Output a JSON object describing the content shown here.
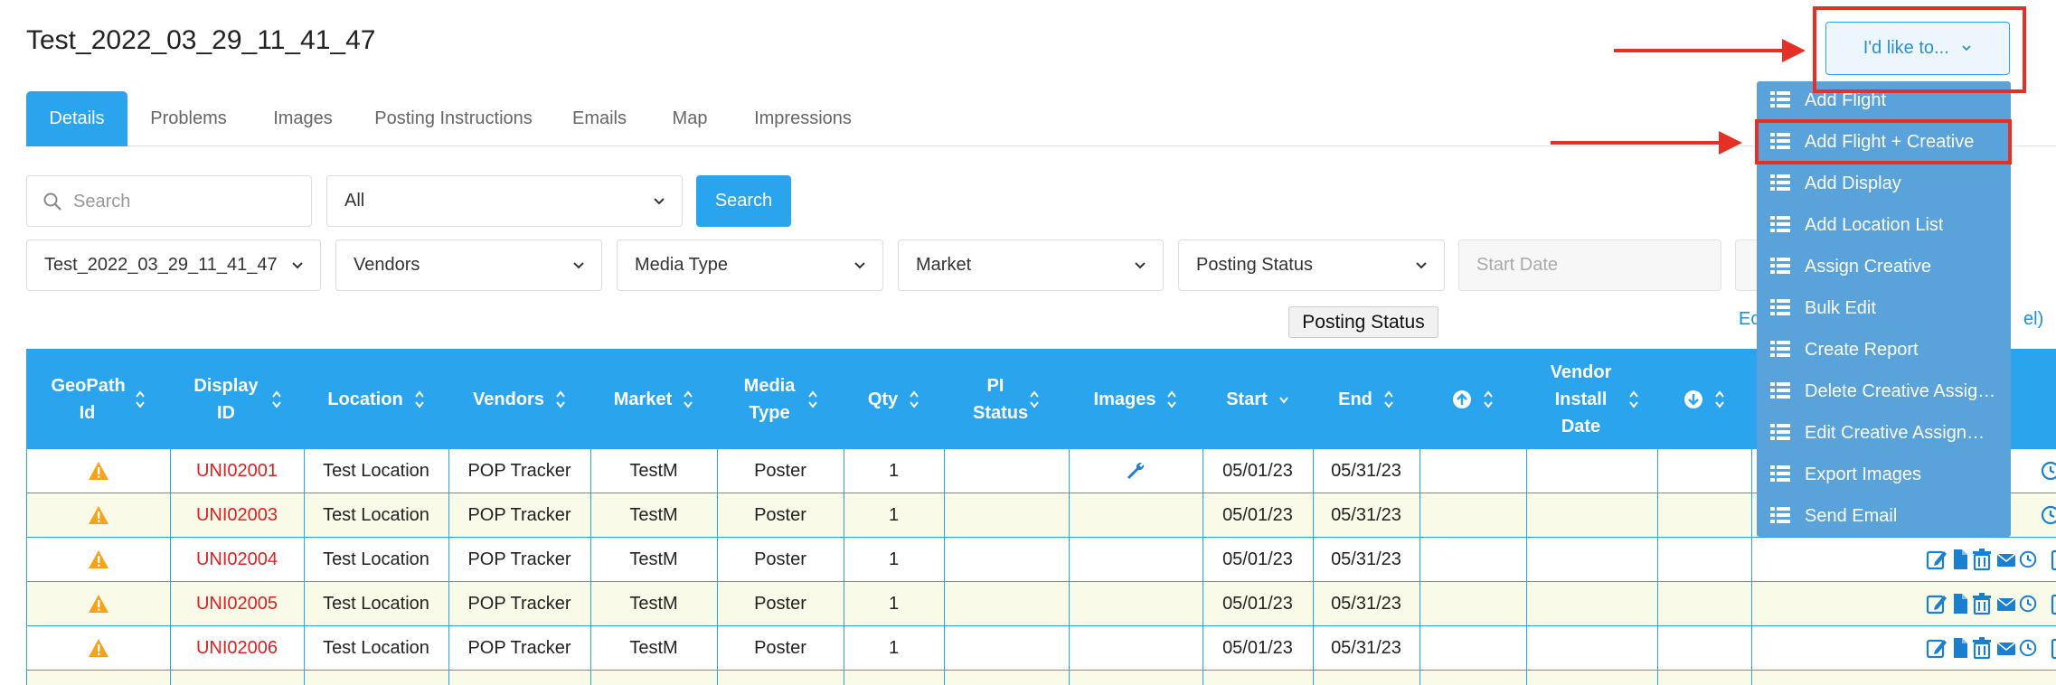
{
  "page_title": "Test_2022_03_29_11_41_47",
  "tabs": [
    "Details",
    "Problems",
    "Images",
    "Posting Instructions",
    "Emails",
    "Map",
    "Impressions"
  ],
  "search": {
    "placeholder": "Search",
    "scope_value": "All",
    "button_label": "Search"
  },
  "filters": {
    "campaign": "Test_2022_03_29_11_41_47",
    "vendors": "Vendors",
    "media_type": "Media Type",
    "market": "Market",
    "posting_status": "Posting Status",
    "start_date_placeholder": "Start Date"
  },
  "tooltip": "Posting Status",
  "link_fragments": [
    "Ec",
    "el)"
  ],
  "actions_button": {
    "label": "I'd like to...",
    "chevron": "chevron-down-icon"
  },
  "actions_menu": [
    "Add Flight",
    "Add Flight + Creative",
    "Add Display",
    "Add Location List",
    "Assign Creative",
    "Bulk Edit",
    "Create Report",
    "Delete Creative Assig…",
    "Edit Creative Assign…",
    "Export Images",
    "Send Email"
  ],
  "table": {
    "headers": {
      "geopath": "GeoPath Id",
      "display_id": "Display ID",
      "location": "Location",
      "vendors": "Vendors",
      "market": "Market",
      "media_type": "Media Type",
      "qty": "Qty",
      "pi_status": "PI Status",
      "images": "Images",
      "start": "Start",
      "end": "End",
      "vendor_install": "Vendor Install Date"
    },
    "header_icons": [
      "upload-circle-icon",
      "download-circle-icon"
    ],
    "rows": [
      {
        "display_id": "UNI02001",
        "location": "Test Location",
        "vendor": "POP Tracker",
        "market": "TestM",
        "media_type": "Poster",
        "qty": "1",
        "start": "05/01/23",
        "end": "05/31/23",
        "has_image": true
      },
      {
        "display_id": "UNI02003",
        "location": "Test Location",
        "vendor": "POP Tracker",
        "market": "TestM",
        "media_type": "Poster",
        "qty": "1",
        "start": "05/01/23",
        "end": "05/31/23",
        "has_image": false
      },
      {
        "display_id": "UNI02004",
        "location": "Test Location",
        "vendor": "POP Tracker",
        "market": "TestM",
        "media_type": "Poster",
        "qty": "1",
        "start": "05/01/23",
        "end": "05/31/23",
        "has_image": false
      },
      {
        "display_id": "UNI02005",
        "location": "Test Location",
        "vendor": "POP Tracker",
        "market": "TestM",
        "media_type": "Poster",
        "qty": "1",
        "start": "05/01/23",
        "end": "05/31/23",
        "has_image": false
      },
      {
        "display_id": "UNI02006",
        "location": "Test Location",
        "vendor": "POP Tracker",
        "market": "TestM",
        "media_type": "Poster",
        "qty": "1",
        "start": "05/01/23",
        "end": "05/31/23",
        "has_image": false
      }
    ]
  },
  "colors": {
    "primary": "#2ba4ee",
    "menu_bg": "#59a3da",
    "highlight": "#e53026",
    "warning": "#f7a21b",
    "display_id": "#e02020"
  }
}
